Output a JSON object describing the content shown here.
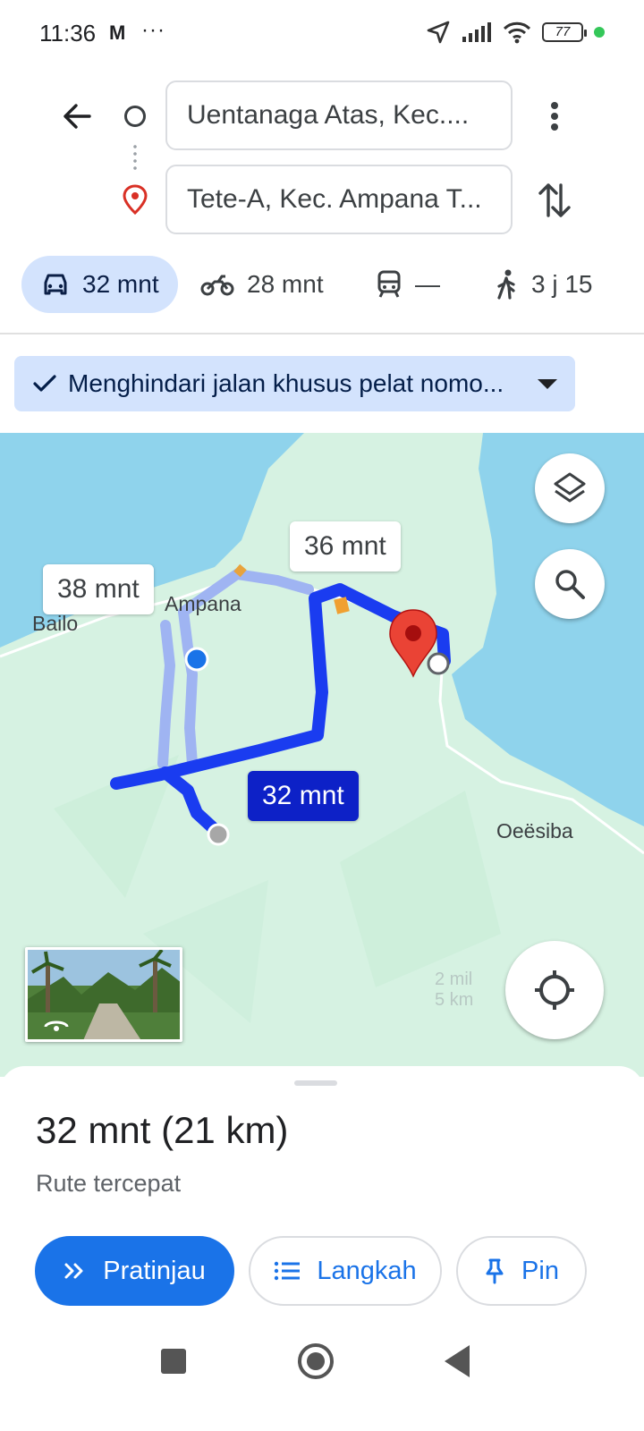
{
  "status": {
    "time": "11:36",
    "mail_icon": "M",
    "more": "···",
    "battery": "77"
  },
  "search": {
    "origin": "Uentanaga Atas, Kec....",
    "destination": "Tete-A, Kec. Ampana T..."
  },
  "modes": {
    "car": "32 mnt",
    "motorcycle": "28 mnt",
    "transit": "—",
    "walk": "3 j 15"
  },
  "avoid_chip": "Menghindari jalan khusus pelat nomo...",
  "map": {
    "labels": {
      "bailo": "Bailo",
      "ampana": "Ampana",
      "oeesiba": "Oeësiba"
    },
    "callouts": {
      "alt1": "38 mnt",
      "alt2": "36 mnt",
      "main": "32 mnt"
    },
    "scale_mi": "2 mil",
    "scale_km": "5 km",
    "colors": {
      "route_primary": "#1a3cf0",
      "route_alt": "#9fb4f2",
      "land": "#d6f2e2",
      "water": "#8fd3ec",
      "pin": "#ea4335"
    }
  },
  "sheet": {
    "duration": "32 mnt",
    "distance": "(21 km)",
    "route_type": "Rute tercepat",
    "preview_label": "Pratinjau",
    "steps_label": "Langkah",
    "pin_label": "Pin"
  }
}
